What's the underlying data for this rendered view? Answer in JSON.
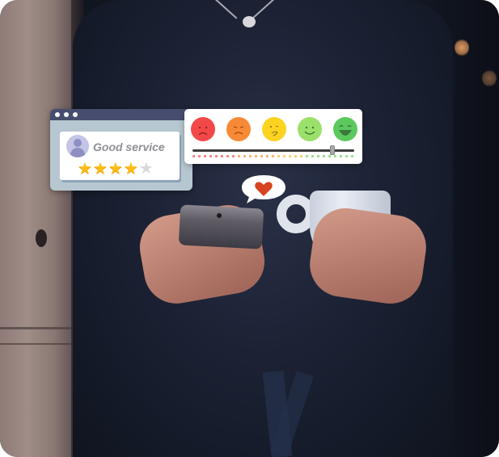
{
  "review_widget": {
    "window_dots": 3,
    "title": "Good service",
    "avatar_icon": "user-icon",
    "rating": {
      "value": 4,
      "max": 5
    },
    "colors": {
      "titlebar": "#464d6e",
      "frame": "#b7c7d1",
      "star_on": "#fdbd13",
      "star_off": "#d9d9d9"
    }
  },
  "mood_widget": {
    "faces": [
      {
        "label": "very-unhappy",
        "color": "#f24848"
      },
      {
        "label": "unhappy",
        "color": "#f78a36"
      },
      {
        "label": "neutral",
        "color": "#fcd321"
      },
      {
        "label": "happy",
        "color": "#9be06b"
      },
      {
        "label": "very-happy",
        "color": "#5cc95e"
      }
    ],
    "slider": {
      "value_fraction": 0.86,
      "min_symbol": "−",
      "max_symbol": "+"
    }
  },
  "reaction_bubble": {
    "icon": "heart-icon",
    "color": "#d8441f"
  },
  "background_photo": {
    "description": "Person in dark shirt holding a smartphone and a white coffee cup"
  }
}
